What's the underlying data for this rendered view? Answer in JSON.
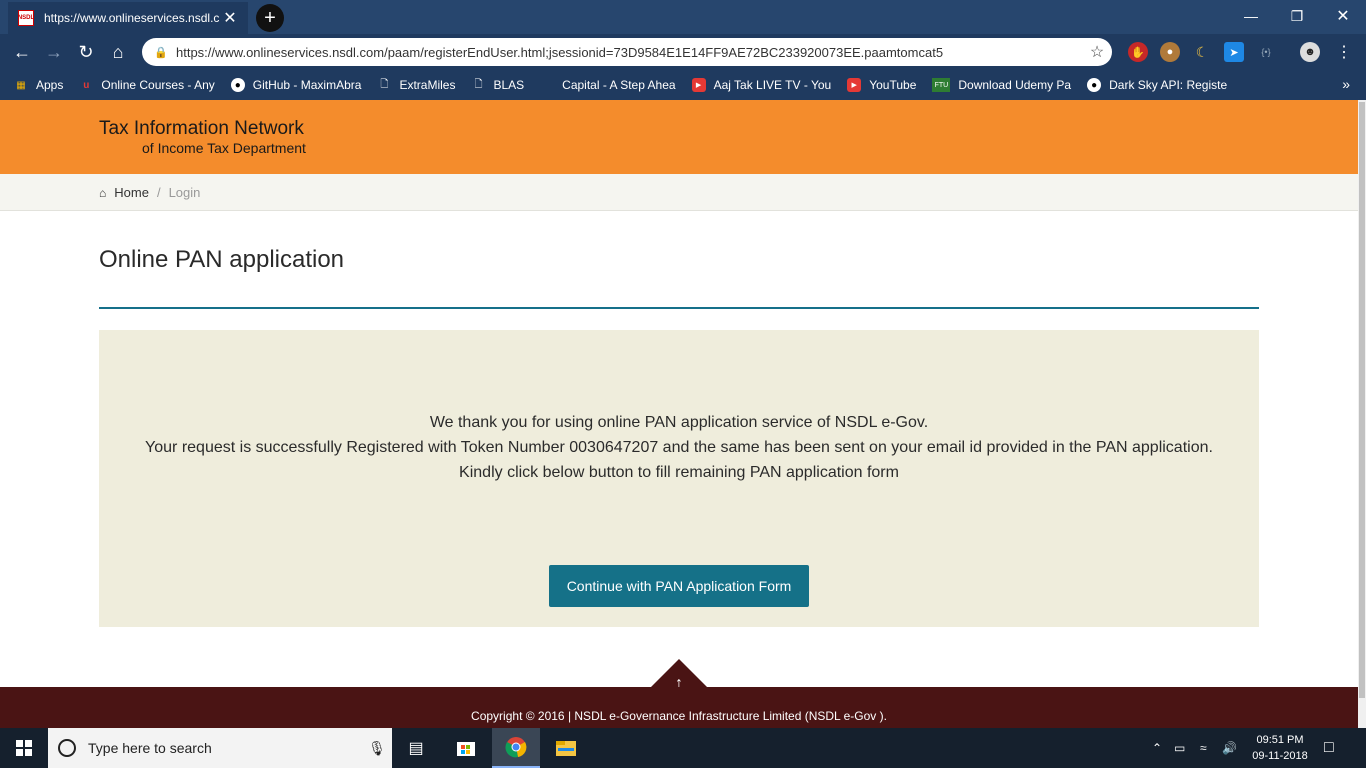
{
  "browser": {
    "tab_title": "https://www.onlineservices.nsdl.c",
    "tab_close": "✕",
    "favicon_text": "NSDL",
    "new_tab": "+",
    "url": "https://www.onlineservices.nsdl.com/paam/registerEndUser.html;jsessionid=73D9584E1E14FF9AE72BC233920073EE.paamtomcat5",
    "bookmarks": [
      {
        "label": "Apps",
        "icon": "apps-grid-icon"
      },
      {
        "label": "Online Courses - Any",
        "icon": "udemy-icon"
      },
      {
        "label": "GitHub - MaximAbra",
        "icon": "github-icon"
      },
      {
        "label": "ExtraMiles",
        "icon": "page-icon"
      },
      {
        "label": "BLAS",
        "icon": "page-icon"
      },
      {
        "label": "Capital - A Step Ahea",
        "icon": "blank-icon"
      },
      {
        "label": "Aaj Tak LIVE TV - You",
        "icon": "youtube-icon"
      },
      {
        "label": "YouTube",
        "icon": "youtube-icon"
      },
      {
        "label": "Download Udemy Pa",
        "icon": "ftu-icon"
      },
      {
        "label": "Dark Sky API: Registe",
        "icon": "darksky-icon"
      }
    ],
    "ftu_text": "FTU"
  },
  "site": {
    "logo_line1": "Tax Information Network",
    "logo_line2": "of Income Tax Department",
    "breadcrumb": {
      "home": "Home",
      "separator": "/",
      "current": "Login"
    },
    "page_title": "Online PAN application",
    "message": {
      "line1": "We thank you for using online PAN application service of NSDL e-Gov.",
      "line2": "Your request is successfully Registered with Token Number 0030647207 and the same has been sent on your email id provided in the PAN application.",
      "line3": "Kindly click below button to fill remaining PAN application form"
    },
    "cta_label": "Continue with PAN Application Form",
    "back_to_top": "↑",
    "copyright": "Copyright © 2016 | NSDL e-Governance Infrastructure Limited (NSDL e-Gov )."
  },
  "taskbar": {
    "search_placeholder": "Type here to search",
    "time": "09:51 PM",
    "date": "09-11-2018"
  },
  "colors": {
    "header_orange": "#f48c2c",
    "accent_teal": "#157188",
    "footer_maroon": "#4a1414",
    "message_box": "#efeddc"
  }
}
